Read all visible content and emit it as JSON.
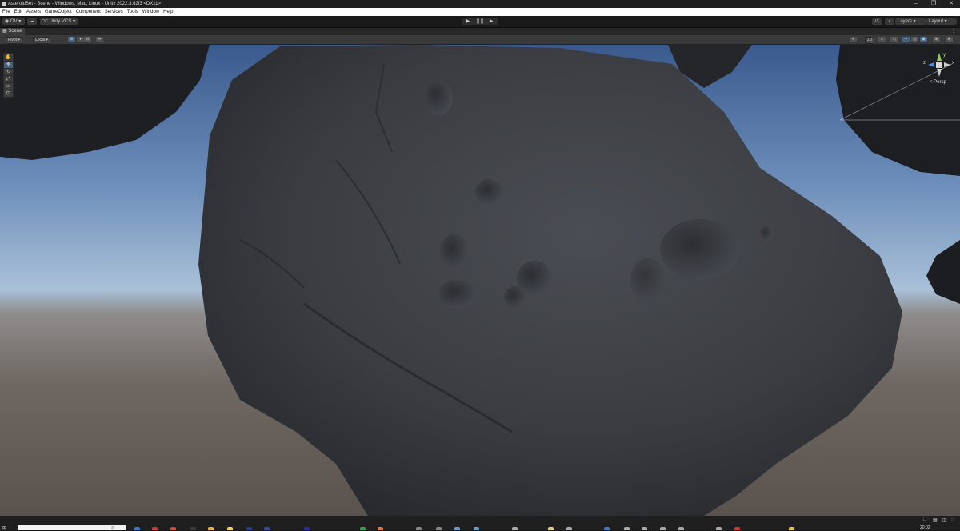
{
  "window": {
    "title": "AsteroidSet - Scene - Windows, Mac, Linux - Unity 2022.3.62f3 <DX11>",
    "controls": [
      "–",
      "❐",
      "✕"
    ]
  },
  "menu": [
    "File",
    "Edit",
    "Assets",
    "GameObject",
    "Component",
    "Services",
    "Tools",
    "Window",
    "Help"
  ],
  "toolbar": {
    "account_label": "OV",
    "vcs_label": "Unity VCS",
    "play_icon": "play-icon",
    "pause_icon": "pause-icon",
    "step_icon": "step-icon",
    "layers_label": "Layers",
    "layout_label": "Layout"
  },
  "scene_tab": {
    "label": "Scene"
  },
  "scene_toolbar": {
    "pivot_label": "Pivot",
    "local_label": "Local",
    "mode_2d_label": "2D"
  },
  "tools": [
    "hand-tool",
    "move-tool",
    "rotate-tool",
    "scale-tool",
    "rect-tool",
    "transform-tool"
  ],
  "gizmo": {
    "x_label": "x",
    "y_label": "y",
    "z_label": "z",
    "projection_label": "< Persp"
  },
  "taskbar": {
    "clock_time": "20:02",
    "search_icon": "search-icon"
  }
}
